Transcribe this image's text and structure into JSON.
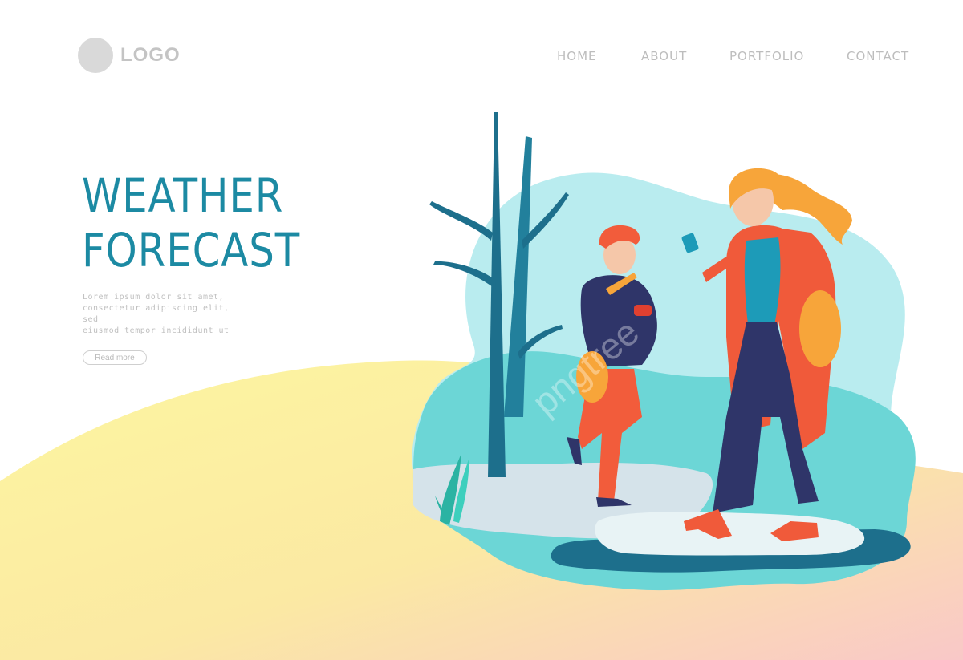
{
  "header": {
    "logo_text": "LOGO",
    "nav": [
      {
        "label": "HOME"
      },
      {
        "label": "ABOUT"
      },
      {
        "label": "PORTFOLIO"
      },
      {
        "label": "CONTACT"
      }
    ]
  },
  "hero": {
    "title_line1": "WEATHER",
    "title_line2": "FORECAST",
    "body_lines": [
      "Lorem ipsum dolor sit amet,",
      "consectetur adipiscing elit, sed",
      "eiusmod tempor incididunt ut"
    ],
    "button_label": "Read more"
  },
  "colors": {
    "accent": "#1c8aa3",
    "nav_text": "#bdbdbd",
    "yellow_wave": "#fdf6a0",
    "pink_wave": "#f9c5c5",
    "scene_teal": "#6cd6d6",
    "scene_light": "#b9ecef",
    "coat_red": "#f05a3a",
    "hair_orange": "#f7a53a",
    "navy": "#2f3569"
  }
}
